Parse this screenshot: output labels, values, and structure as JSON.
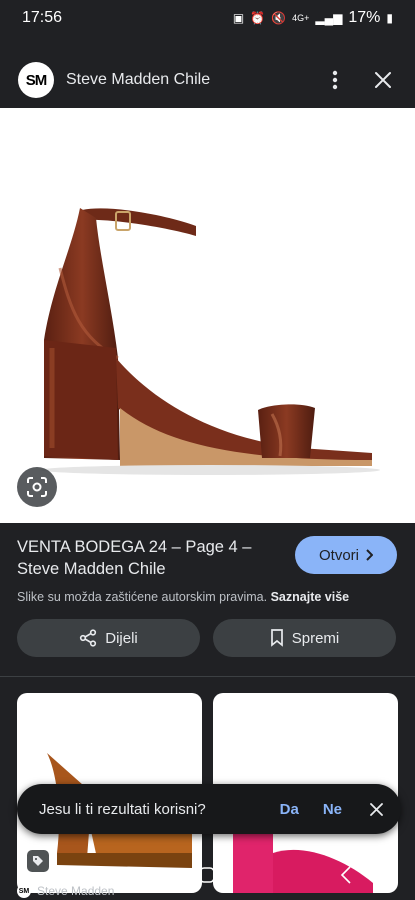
{
  "status_bar": {
    "time": "17:56",
    "network": "4G+",
    "battery": "17%"
  },
  "header": {
    "logo_text": "SM",
    "title": "Steve Madden Chile",
    "more_icon": "more-vert-icon",
    "close_icon": "close-icon"
  },
  "result": {
    "title": "VENTA BODEGA 24 – Page 4 – Steve Madden Chile",
    "open_label": "Otvori",
    "copyright_text": "Slike su možda zaštićene autorskim pravima.",
    "learn_more": "Saznajte više"
  },
  "actions": {
    "share_label": "Dijeli",
    "save_label": "Spremi"
  },
  "feedback": {
    "question": "Jesu li ti rezultati korisni?",
    "yes": "Da",
    "no": "Ne"
  },
  "related": {
    "source": "Steve Madden"
  },
  "colors": {
    "background": "#202124",
    "accent": "#8ab4f8",
    "button_bg": "#3c4043",
    "shoe_main": "#7a2f1c"
  }
}
